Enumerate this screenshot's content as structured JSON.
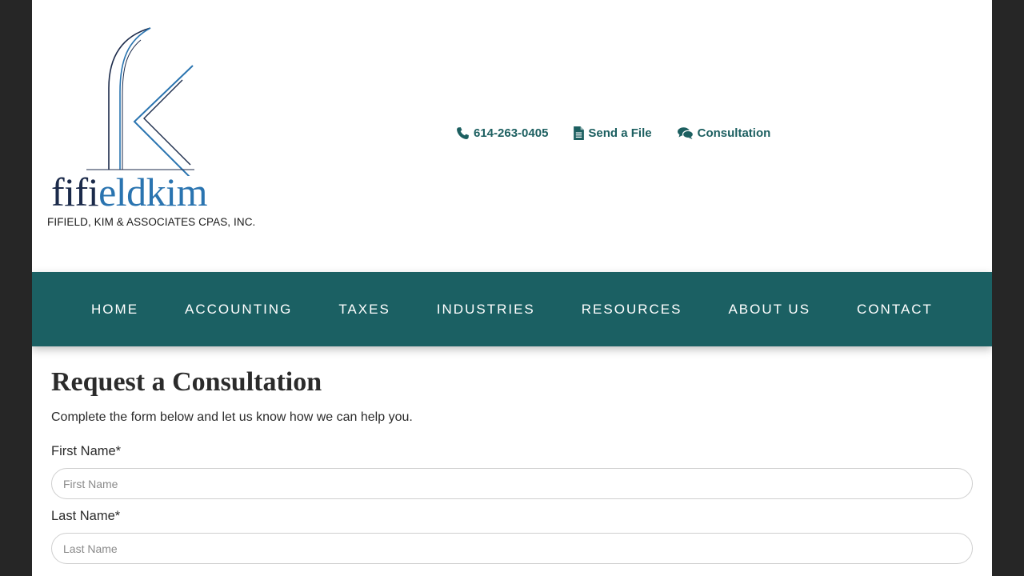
{
  "colors": {
    "accent": "#1b6063",
    "link": "#1c5f60",
    "logo_dark": "#1b2a4a",
    "logo_blue": "#2a74b0"
  },
  "logo": {
    "word_part1": "fifi",
    "word_part2": "eldkim",
    "tagline": "FIFIELD, KIM & ASSOCIATES CPAS, INC."
  },
  "top_links": [
    {
      "label": "614-263-0405",
      "icon": "phone-icon"
    },
    {
      "label": "Send a File",
      "icon": "file-icon"
    },
    {
      "label": "Consultation",
      "icon": "comments-icon"
    }
  ],
  "nav": {
    "items": [
      "HOME",
      "ACCOUNTING",
      "TAXES",
      "INDUSTRIES",
      "RESOURCES",
      "ABOUT US",
      "CONTACT"
    ]
  },
  "page": {
    "title": "Request a Consultation",
    "intro": "Complete the form below and let us know how we can help you."
  },
  "form": {
    "first_name": {
      "label": "First Name*",
      "placeholder": "First Name",
      "value": ""
    },
    "last_name": {
      "label": "Last Name*",
      "placeholder": "Last Name",
      "value": ""
    }
  }
}
